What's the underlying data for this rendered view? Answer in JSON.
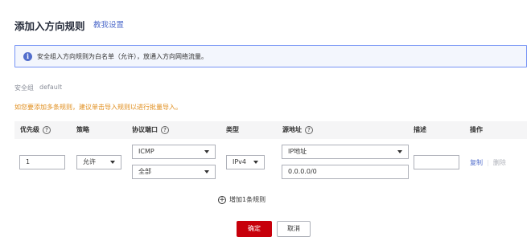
{
  "header": {
    "title": "添加入方向规则",
    "help_link": "教我设置"
  },
  "info": {
    "icon": "info-icon",
    "text": "安全组入方向规则为白名单（允许），放通入方向网络流量。"
  },
  "security_group": {
    "label": "安全组",
    "value": "default"
  },
  "tip": "如您要添加多条规则，建议单击导入规则以进行批量导入。",
  "table": {
    "columns": {
      "priority": "优先级",
      "policy": "策略",
      "protocol_port": "协议端口",
      "type": "类型",
      "source": "源地址",
      "description": "描述",
      "operation": "操作"
    },
    "row": {
      "priority": "1",
      "policy": "允许",
      "protocol": "ICMP",
      "port": "全部",
      "type": "IPv4",
      "source_type": "IP地址",
      "source_value": "0.0.0.0/0",
      "description": "",
      "op_copy": "复制",
      "op_delete": "删除"
    }
  },
  "add_rule": "增加1条规则",
  "buttons": {
    "ok": "确定",
    "cancel": "取消"
  },
  "colors": {
    "accent": "#526ecc",
    "primary_button": "#c7000b",
    "tip": "#e08d1b"
  }
}
